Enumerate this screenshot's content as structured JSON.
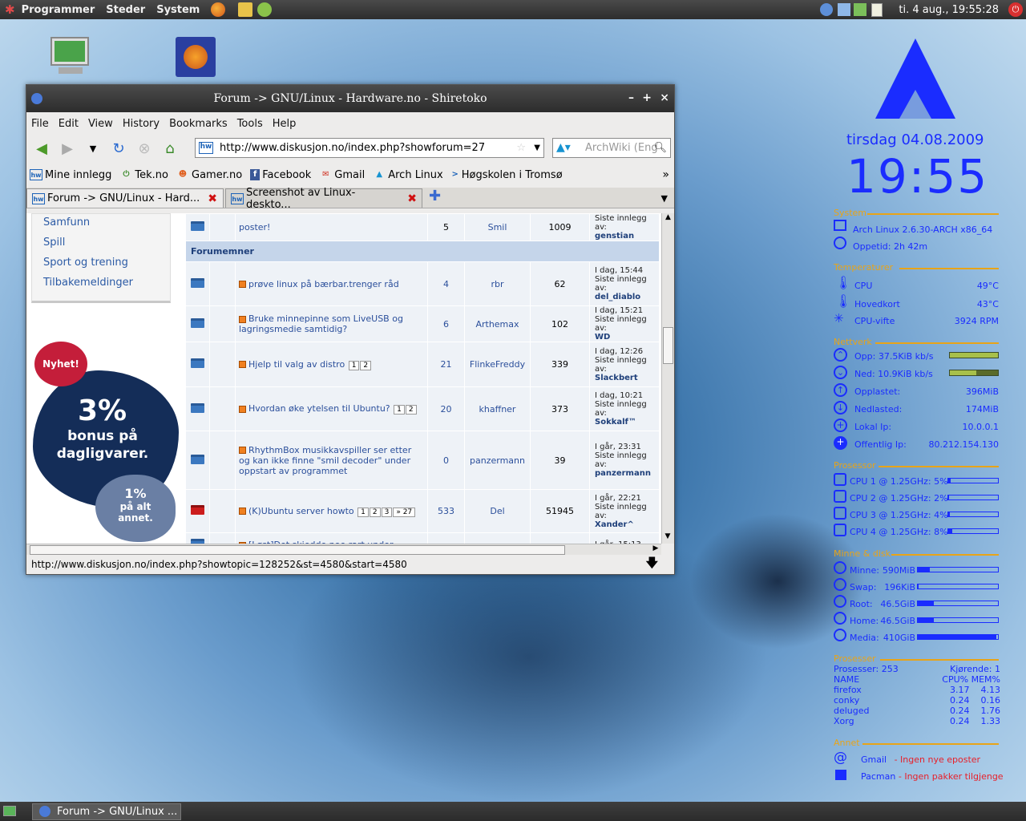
{
  "top_panel": {
    "menus": [
      "Programmer",
      "Steder",
      "System"
    ],
    "clock": "ti. 4 aug., 19:55:28"
  },
  "window": {
    "title": "Forum -> GNU/Linux - Hardware.no - Shiretoko",
    "close": "×",
    "minimize": "–",
    "maximize": "+"
  },
  "menubar": [
    "File",
    "Edit",
    "View",
    "History",
    "Bookmarks",
    "Tools",
    "Help"
  ],
  "navbar": {
    "url": "http://www.diskusjon.no/index.php?showforum=27",
    "search_placeholder": "ArchWiki (Eng"
  },
  "bookmarks": [
    {
      "label": "Mine innlegg",
      "icon": "hw"
    },
    {
      "label": "Tek.no",
      "icon": "tek"
    },
    {
      "label": "Gamer.no",
      "icon": "gamer"
    },
    {
      "label": "Facebook",
      "icon": "f"
    },
    {
      "label": "Gmail",
      "icon": "gmail"
    },
    {
      "label": "Arch Linux",
      "icon": "arch"
    },
    {
      "label": "Høgskolen i Tromsø",
      "icon": ">"
    }
  ],
  "tabs": [
    {
      "label": "Forum -> GNU/Linux - Hard..."
    },
    {
      "label": "Screenshot av Linux-deskto..."
    }
  ],
  "sidebar": {
    "categories": [
      "Samfunn",
      "Spill",
      "Sport og trening",
      "Tilbakemeldinger"
    ]
  },
  "ad": {
    "badge": "Nyhet!",
    "big": "3%",
    "line1": "bonus på",
    "line2": "dagligvarer.",
    "small_big": "1%",
    "small1": "på alt",
    "small2": "annet."
  },
  "forum": {
    "prev_row": {
      "title": "poster!",
      "replies": "5",
      "author": "Smil",
      "views": "1009",
      "lp_label": "Siste innlegg av:",
      "lp_user": "genstian"
    },
    "section": "Forumemner",
    "rows": [
      {
        "title": "prøve linux på bærbar.trenger råd",
        "replies": "4",
        "author": "rbr",
        "views": "62",
        "lp_time": "I dag, 15:44",
        "lp_label": "Siste innlegg av:",
        "lp_user": "del_diablo",
        "pages": []
      },
      {
        "title": "Bruke minnepinne som LiveUSB og lagringsmedie samtidig?",
        "replies": "6",
        "author": "Arthemax",
        "views": "102",
        "lp_time": "I dag, 15:21",
        "lp_label": "Siste innlegg av:",
        "lp_user": "WD",
        "pages": []
      },
      {
        "title": "Hjelp til valg av distro",
        "replies": "21",
        "author": "FlinkeFreddy",
        "views": "339",
        "lp_time": "I dag, 12:26",
        "lp_label": "Siste innlegg av:",
        "lp_user": "Slackbert",
        "pages": [
          "1",
          "2"
        ]
      },
      {
        "title": "Hvordan øke ytelsen til Ubuntu?",
        "replies": "20",
        "author": "khaffner",
        "views": "373",
        "lp_time": "I dag, 10:21",
        "lp_label": "Siste innlegg av:",
        "lp_user": "Sokkalf™",
        "pages": [
          "1",
          "2"
        ]
      },
      {
        "title": "RhythmBox musikkavspiller ser etter og kan ikke finne \"smil decoder\" under oppstart av programmet",
        "replies": "0",
        "author": "panzermann",
        "views": "39",
        "lp_time": "I går, 23:31",
        "lp_label": "Siste innlegg av:",
        "lp_user": "panzermann",
        "pages": []
      },
      {
        "title": "(K)Ubuntu server howto",
        "replies": "533",
        "author": "Del",
        "views": "51945",
        "lp_time": "I går, 22:21",
        "lp_label": "Siste innlegg av:",
        "lp_user": "Xander^",
        "pages": [
          "1",
          "2",
          "3",
          "» 27"
        ]
      },
      {
        "title": "[Løst]Det skjedde noe rart under",
        "replies": "",
        "author": "",
        "views": "",
        "lp_time": "I går, 15:13",
        "lp_label": "",
        "lp_user": "",
        "pages": []
      }
    ]
  },
  "status": "http://www.diskusjon.no/index.php?showtopic=128252&st=4580&start=4580",
  "conky": {
    "date": "tirsdag 04.08.2009",
    "time": "19:55",
    "system": {
      "header": "System",
      "os": "Arch Linux 2.6.30-ARCH  x86_64",
      "uptime": "Oppetid: 2h 42m"
    },
    "temp": {
      "header": "Temperaturer",
      "rows": [
        {
          "label": "CPU",
          "value": "49°C"
        },
        {
          "label": "Hovedkort",
          "value": "43°C"
        },
        {
          "label": "CPU-vifte",
          "value": "3924 RPM"
        }
      ]
    },
    "net": {
      "header": "Nettverk",
      "up": "Opp: 37.5KiB kb/s",
      "down": "Ned: 10.9KiB kb/s",
      "uploaded_label": "Opplastet:",
      "uploaded": "396MiB",
      "downloaded_label": "Nedlasted:",
      "downloaded": "174MiB",
      "lan_label": "Lokal Ip:",
      "lan": "10.0.0.1",
      "wan_label": "Offentlig Ip:",
      "wan": "80.212.154.130"
    },
    "cpu": {
      "header": "Prosessor",
      "rows": [
        {
          "label": "CPU 1 @ 1.25GHz: 5%",
          "pct": 5
        },
        {
          "label": "CPU 2 @ 1.25GHz: 2%",
          "pct": 2
        },
        {
          "label": "CPU 3 @ 1.25GHz: 4%",
          "pct": 4
        },
        {
          "label": "CPU 4 @ 1.25GHz: 8%",
          "pct": 8
        }
      ]
    },
    "mem": {
      "header": "Minne & disk",
      "rows": [
        {
          "label": "Minne:",
          "value": "590MiB",
          "pct": 15
        },
        {
          "label": "Swap:",
          "value": "196KiB",
          "pct": 1
        },
        {
          "label": "Root:",
          "value": "46.5GiB",
          "pct": 20
        },
        {
          "label": "Home:",
          "value": "46.5GiB",
          "pct": 20
        },
        {
          "label": "Media:",
          "value": "410GiB",
          "pct": 98
        }
      ]
    },
    "proc": {
      "header": "Prosesser",
      "count": "Prosesser: 253",
      "running": "Kjørende: 1",
      "cols": [
        "NAME",
        "CPU% MEM%"
      ],
      "rows": [
        [
          "firefox",
          "3.17",
          "4.13"
        ],
        [
          "conky",
          "0.24",
          "0.16"
        ],
        [
          "deluged",
          "0.24",
          "1.76"
        ],
        [
          "Xorg",
          "0.24",
          "1.33"
        ]
      ]
    },
    "other": {
      "header": "Annet",
      "gmail": "Gmail",
      "gmail_status": "- Ingen nye eposter",
      "pacman": "Pacman",
      "pacman_status": "- Ingen pakker tilgjenge"
    }
  },
  "taskbar": {
    "label": "Forum -> GNU/Linux ..."
  }
}
